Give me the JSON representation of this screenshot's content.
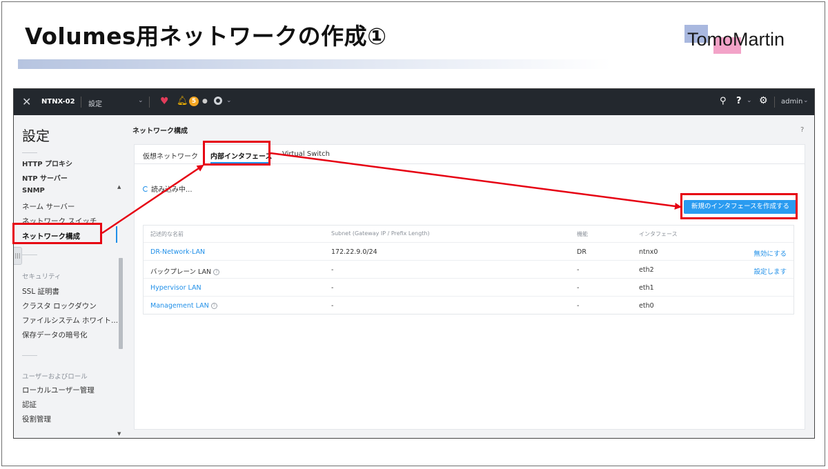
{
  "slide": {
    "title": "Volumes用ネットワークの作成①",
    "logo_text": "TomoMartin"
  },
  "topbar": {
    "cluster_name": "NTNX-02",
    "menu_label": "設定",
    "alert_count": "5",
    "user_label": "admin"
  },
  "sidebar": {
    "title": "設定",
    "items_group1": [
      "HTTP プロキシ",
      "NTP サーバー",
      "SNMP",
      "ネーム サーバー",
      "ネットワーク スイッチ",
      "ネットワーク構成"
    ],
    "section_security": "セキュリティ",
    "items_group2": [
      "SSL 証明書",
      "クラスタ ロックダウン",
      "ファイルシステム ホワイト...",
      "保存データの暗号化"
    ],
    "section_users": "ユーザーおよびロール",
    "items_group3": [
      "ローカルユーザー管理",
      "認証",
      "役割管理"
    ]
  },
  "main": {
    "title": "ネットワーク構成",
    "help": "?",
    "tabs": [
      "仮想ネットワーク",
      "内部インタフェース",
      "Virtual Switch"
    ],
    "active_tab": "内部インタフェース",
    "loading_text": "読み込み中...",
    "create_button": "新規のインタフェースを作成する",
    "table": {
      "headers": [
        "記述的な名前",
        "Subnet (Gateway IP / Prefix Length)",
        "機能",
        "インタフェース"
      ],
      "rows": [
        {
          "name": "DR-Network-LAN",
          "subnet": "172.22.9.0/24",
          "function": "DR",
          "interface": "ntnx0",
          "action": "無効にする"
        },
        {
          "name": "バックプレーン LAN",
          "subnet": "-",
          "function": "-",
          "interface": "eth2",
          "action": "設定します"
        },
        {
          "name": "Hypervisor LAN",
          "subnet": "-",
          "function": "-",
          "interface": "eth1",
          "action": ""
        },
        {
          "name": "Management LAN",
          "subnet": "-",
          "function": "-",
          "interface": "eth0",
          "action": ""
        }
      ]
    }
  },
  "colors": {
    "annotation_red": "#e60012",
    "accent_blue": "#2a9bf0",
    "topbar_bg": "#23282e"
  }
}
